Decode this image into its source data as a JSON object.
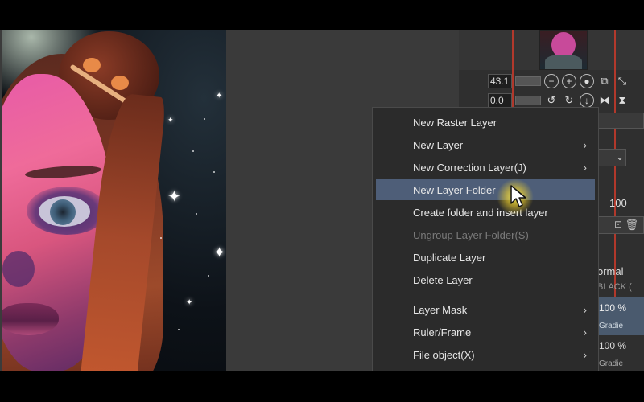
{
  "context_menu": {
    "items": [
      {
        "label": "New Raster Layer",
        "submenu": false,
        "enabled": true
      },
      {
        "label": "New Layer",
        "submenu": true,
        "enabled": true
      },
      {
        "label": "New Correction Layer(J)",
        "submenu": true,
        "enabled": true
      },
      {
        "label": "New Layer Folder",
        "submenu": false,
        "enabled": true,
        "highlighted": true
      },
      {
        "label": "Create folder and insert layer",
        "submenu": false,
        "enabled": true
      },
      {
        "label": "Ungroup Layer Folder(S)",
        "submenu": false,
        "enabled": false
      },
      {
        "label": "Duplicate Layer",
        "submenu": false,
        "enabled": true
      },
      {
        "label": "Delete Layer",
        "submenu": false,
        "enabled": true
      },
      {
        "label": "Layer Mask",
        "submenu": true,
        "enabled": true
      },
      {
        "label": "Ruler/Frame",
        "submenu": true,
        "enabled": true
      },
      {
        "label": "File object(X)",
        "submenu": true,
        "enabled": true
      }
    ]
  },
  "navigator": {
    "zoom_value": "43.1",
    "rotation_value": "0.0"
  },
  "layer_panel": {
    "opacity": "100",
    "blend_mode_partial": "ormal",
    "layer_name_partial": "BLACK (",
    "layer1_opacity": "100 %",
    "layer1_name_partial": "Gradie",
    "layer2_opacity": "100 %",
    "layer2_name_partial": "Gradie"
  },
  "colors": {
    "menu_bg": "#2b2b2b",
    "menu_highlight": "#4e5e78",
    "menu_text": "#e6e6e6",
    "menu_disabled": "#7a7a7a",
    "panel_bg": "#2f2f2f"
  }
}
